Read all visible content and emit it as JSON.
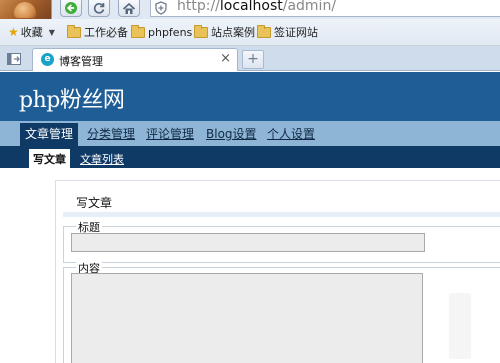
{
  "browser": {
    "address_prefix": "http://",
    "address_host": "localhost",
    "address_path": "/admin/",
    "bookmarks": [
      {
        "label": "收藏",
        "icon": "star-icon"
      },
      {
        "label": "工作必备",
        "icon": "folder-icon"
      },
      {
        "label": "phpfens",
        "icon": "folder-icon"
      },
      {
        "label": "站点案例",
        "icon": "folder-icon"
      },
      {
        "label": "签证网站",
        "icon": "folder-icon"
      }
    ],
    "tab": {
      "title": "博客管理",
      "close": "×"
    },
    "new_tab": "+"
  },
  "site": {
    "title": "php粉丝网"
  },
  "nav_primary": [
    {
      "label": "文章管理",
      "active": true
    },
    {
      "label": "分类管理",
      "active": false
    },
    {
      "label": "评论管理",
      "active": false
    },
    {
      "label": "Blog设置",
      "active": false
    },
    {
      "label": "个人设置",
      "active": false
    }
  ],
  "nav_secondary": [
    {
      "label": "写文章",
      "active": true
    },
    {
      "label": "文章列表",
      "active": false
    }
  ],
  "form": {
    "heading": "写文章",
    "title_label": "标题",
    "title_value": "",
    "content_label": "内容",
    "content_value": ""
  }
}
